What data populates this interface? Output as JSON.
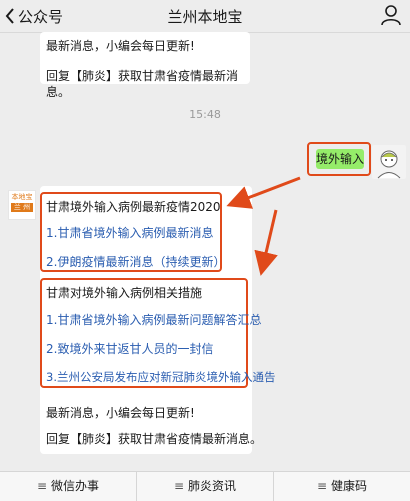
{
  "header": {
    "back_label": "公众号",
    "title": "兰州本地宝"
  },
  "messages": {
    "top_partial": {
      "line1": "最新消息，小编会每日更新!",
      "line2": "回复【肺炎】获取甘肃省疫情最新消息。"
    },
    "timestamp": "15:48",
    "user_message": "境外输入",
    "section1": {
      "title": "甘肃境外输入病例最新疫情2020",
      "links": [
        "1.甘肃省境外输入病例最新消息",
        "2.伊朗疫情最新消息（持续更新）"
      ]
    },
    "section2": {
      "title": "甘肃对境外输入病例相关措施",
      "links": [
        "1.甘肃省境外输入病例最新问题解答汇总",
        "2.致境外来甘返甘人员的一封信",
        "3.兰州公安局发布应对新冠肺炎境外输入通告"
      ]
    },
    "footer": {
      "line1": "最新消息，小编会每日更新!",
      "line2": "回复【肺炎】获取甘肃省疫情最新消息。"
    },
    "bot_avatar": {
      "top": "本地宝",
      "bottom": "兰 州"
    }
  },
  "bottom_menu": [
    {
      "label": "微信办事",
      "icon": "menu-icon"
    },
    {
      "label": "肺炎资讯",
      "icon": "menu-icon"
    },
    {
      "label": "健康码",
      "icon": "menu-icon"
    }
  ],
  "colors": {
    "highlight": "#e04a1a",
    "user_bubble": "#95ec69",
    "link": "#2a5db0"
  }
}
